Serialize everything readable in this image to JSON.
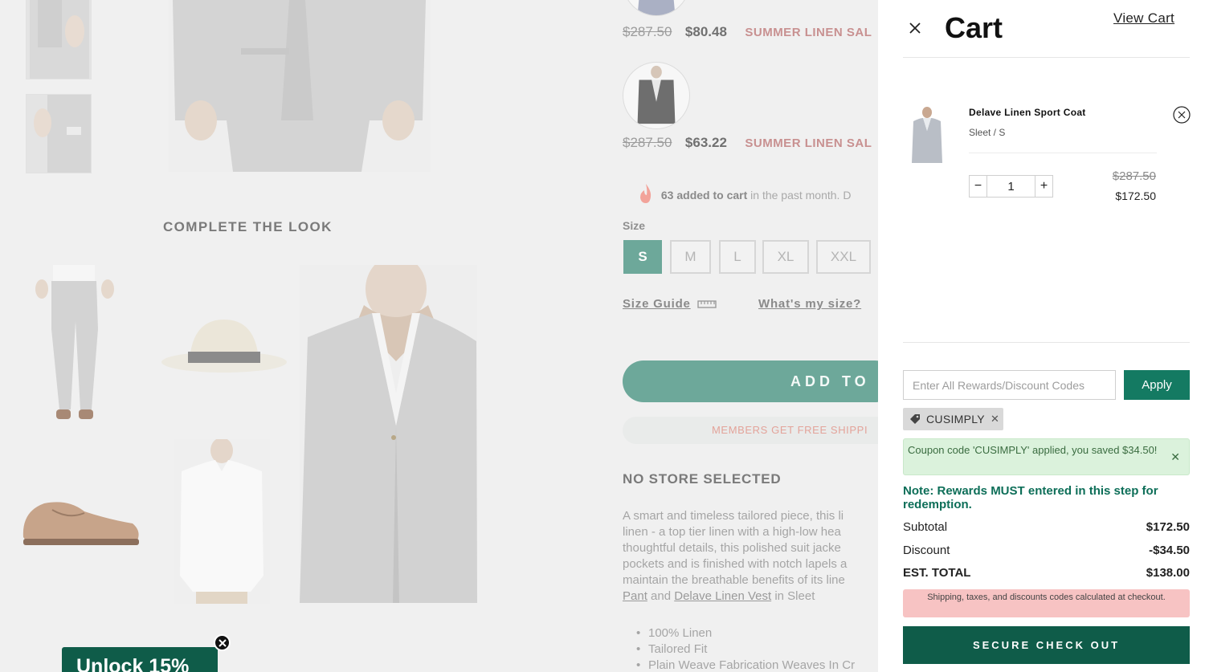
{
  "background": {
    "complete_look_title": "COMPLETE THE LOOK",
    "variants": [
      {
        "original": "$287.50",
        "price": "$80.48",
        "promo": "SUMMER LINEN SAL"
      },
      {
        "original": "$287.50",
        "price": "$63.22",
        "promo": "SUMMER LINEN SAL"
      }
    ],
    "added_bold": "63 added to cart",
    "added_rest": " in the past month. D",
    "size_label": "Size",
    "sizes": [
      "S",
      "M",
      "L",
      "XL",
      "XXL"
    ],
    "selected_size": "S",
    "size_guide": "Size Guide",
    "whats_my_size": "What's my size?",
    "add_to_cart": "ADD TO C",
    "members_shipping": "MEMBERS GET FREE SHIPPI",
    "store_selected": "NO STORE SELECTED",
    "description_lines": [
      "A smart and timeless tailored piece, this li",
      "linen - a top tier linen with a high-low hea",
      "thoughtful details, this polished suit jacke",
      "pockets and is finished with notch lapels a",
      "maintain the breathable benefits of its line"
    ],
    "desc_link1": "Pant",
    "desc_and": " and ",
    "desc_link2": "Delave Linen Vest",
    "desc_tail": " in Sleet",
    "bullets": [
      "100% Linen",
      "Tailored Fit",
      "Plain Weave Fabrication Weaves In Cr"
    ]
  },
  "cart": {
    "title": "Cart",
    "view_cart": "View Cart",
    "item": {
      "name": "Delave Linen Sport Coat",
      "variant": "Sleet / S",
      "quantity": "1",
      "original_price": "$287.50",
      "price": "$172.50"
    },
    "code_placeholder": "Enter All Rewards/Discount Codes",
    "apply_label": "Apply",
    "applied_code": "CUSIMPLY",
    "success_message": "Coupon code 'CUSIMPLY' applied, you saved $34.50!",
    "note": "Note: Rewards MUST entered in this step for redemption.",
    "subtotal_label": "Subtotal",
    "subtotal": "$172.50",
    "discount_label": "Discount",
    "discount": "-$34.50",
    "total_label": "EST. TOTAL",
    "total": "$138.00",
    "shipping_note": "Shipping, taxes, and discounts codes calculated at checkout.",
    "checkout_label": "SECURE CHECK OUT"
  },
  "popup": {
    "label": "Unlock 15%"
  },
  "colors": {
    "brand_green": "#0f5c49",
    "apply_green": "#147a62",
    "success_bg": "#dbf2dc",
    "warning_bg": "#f7c3c3"
  }
}
